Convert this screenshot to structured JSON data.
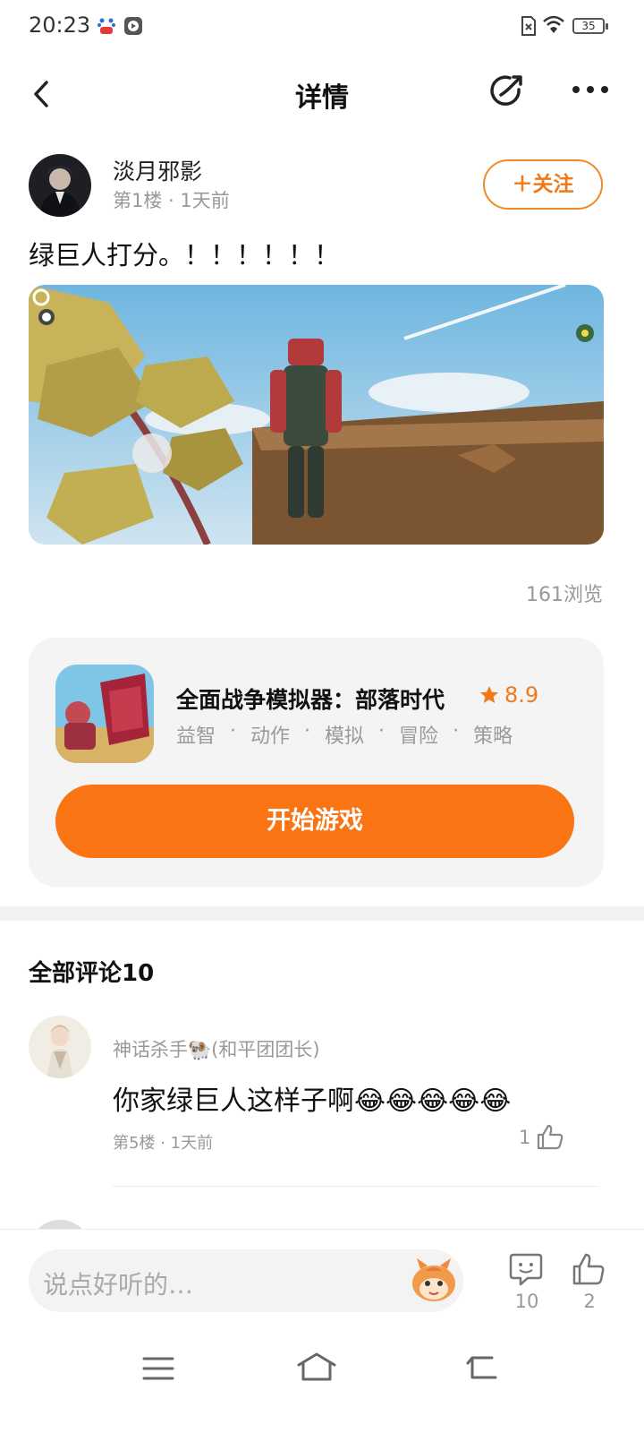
{
  "status_bar": {
    "time": "20:23",
    "battery": "35",
    "icons": [
      "baidu-app-icon",
      "media-app-icon",
      "no-sim-icon",
      "wifi-icon",
      "battery-icon"
    ]
  },
  "header": {
    "title": "详情",
    "icons": [
      "back-arrow-icon",
      "share-icon",
      "more-dots-icon"
    ]
  },
  "post": {
    "author": "淡月邪影",
    "floor": "第1楼",
    "time": "1天前",
    "meta": "第1楼 · 1天前",
    "follow_label": "关注",
    "text": "绿巨人打分。！！！！！！",
    "views": "161浏览"
  },
  "game": {
    "name": "全面战争模拟器：部落时代",
    "rating": "8.9",
    "tags": [
      "益智",
      "动作",
      "模拟",
      "冒险",
      "策略"
    ],
    "play_label": "开始游戏",
    "accent_color": "#fa7414"
  },
  "comments": {
    "title": "全部评论10",
    "items": [
      {
        "user": "神话杀手🐏(和平团团长)",
        "text": "你家绿巨人这样子啊😂😂😂😂😂",
        "meta": "第5楼 · 1天前",
        "likes": "1"
      }
    ]
  },
  "bottom_bar": {
    "input_placeholder": "说点好听的…",
    "comment_count": "10",
    "like_count": "2"
  },
  "nav": {
    "icons": [
      "menu-icon",
      "home-icon",
      "back-icon"
    ]
  }
}
